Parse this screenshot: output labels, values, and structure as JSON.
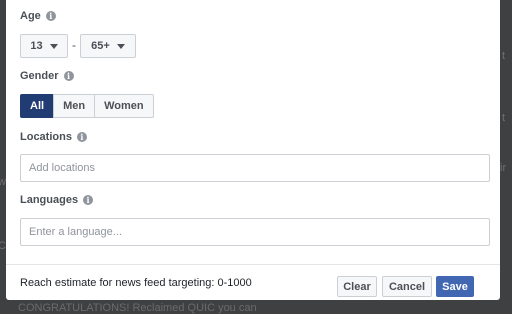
{
  "backdrop": {
    "left_1": "w",
    "left_2": "Ch",
    "bottom": "CONGRATULATIONS! Reclaimed QUIC you can",
    "right_1": "t",
    "right_2": "t",
    "right_3": "ir"
  },
  "age": {
    "label": "Age",
    "min": "13",
    "separator": "-",
    "max": "65+"
  },
  "gender": {
    "label": "Gender",
    "options": [
      "All",
      "Men",
      "Women"
    ],
    "selected": "All"
  },
  "locations": {
    "label": "Locations",
    "placeholder": "Add locations",
    "value": ""
  },
  "languages": {
    "label": "Languages",
    "placeholder": "Enter a language...",
    "value": ""
  },
  "footer": {
    "reach_text": "Reach estimate for news feed targeting: 0-1000",
    "clear": "Clear",
    "cancel": "Cancel",
    "save": "Save"
  },
  "colors": {
    "accent": "#4267b2",
    "selected_segment": "#213b73"
  },
  "icons": {
    "info": "info-icon",
    "dropdown": "caret-down-icon"
  }
}
